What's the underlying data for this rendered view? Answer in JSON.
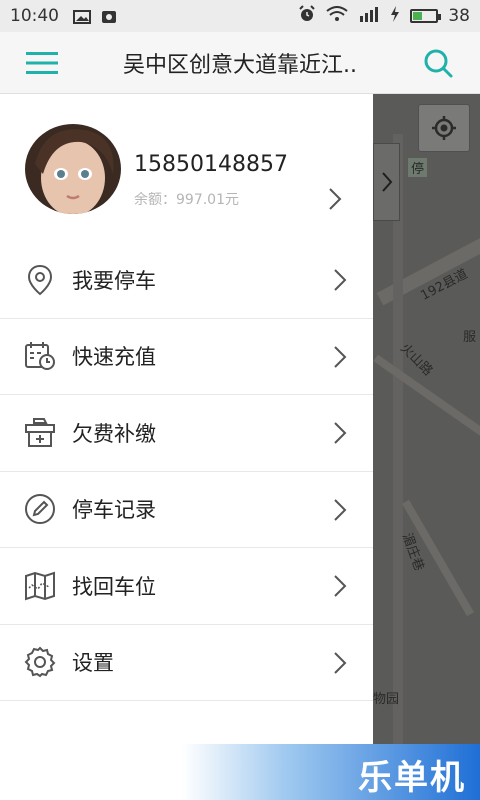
{
  "status_bar": {
    "time": "10:40",
    "battery_level": "38"
  },
  "header": {
    "title": "吴中区创意大道靠近江.."
  },
  "profile": {
    "phone": "15850148857",
    "balance": "余额：997.01元"
  },
  "menu": [
    {
      "label": "我要停车",
      "icon": "location-pin-icon"
    },
    {
      "label": "快速充值",
      "icon": "calendar-clock-icon"
    },
    {
      "label": "欠费补缴",
      "icon": "payment-box-icon"
    },
    {
      "label": "停车记录",
      "icon": "edit-pen-icon"
    },
    {
      "label": "找回车位",
      "icon": "map-icon"
    },
    {
      "label": "设置",
      "icon": "gear-icon"
    }
  ],
  "map": {
    "labels": [
      "192县道",
      "火山路",
      "湄庄巷",
      "物园",
      "服",
      "停"
    ]
  },
  "watermark": "乐单机",
  "colors": {
    "accent": "#20b2aa",
    "map_bg": "#5a5a58"
  }
}
